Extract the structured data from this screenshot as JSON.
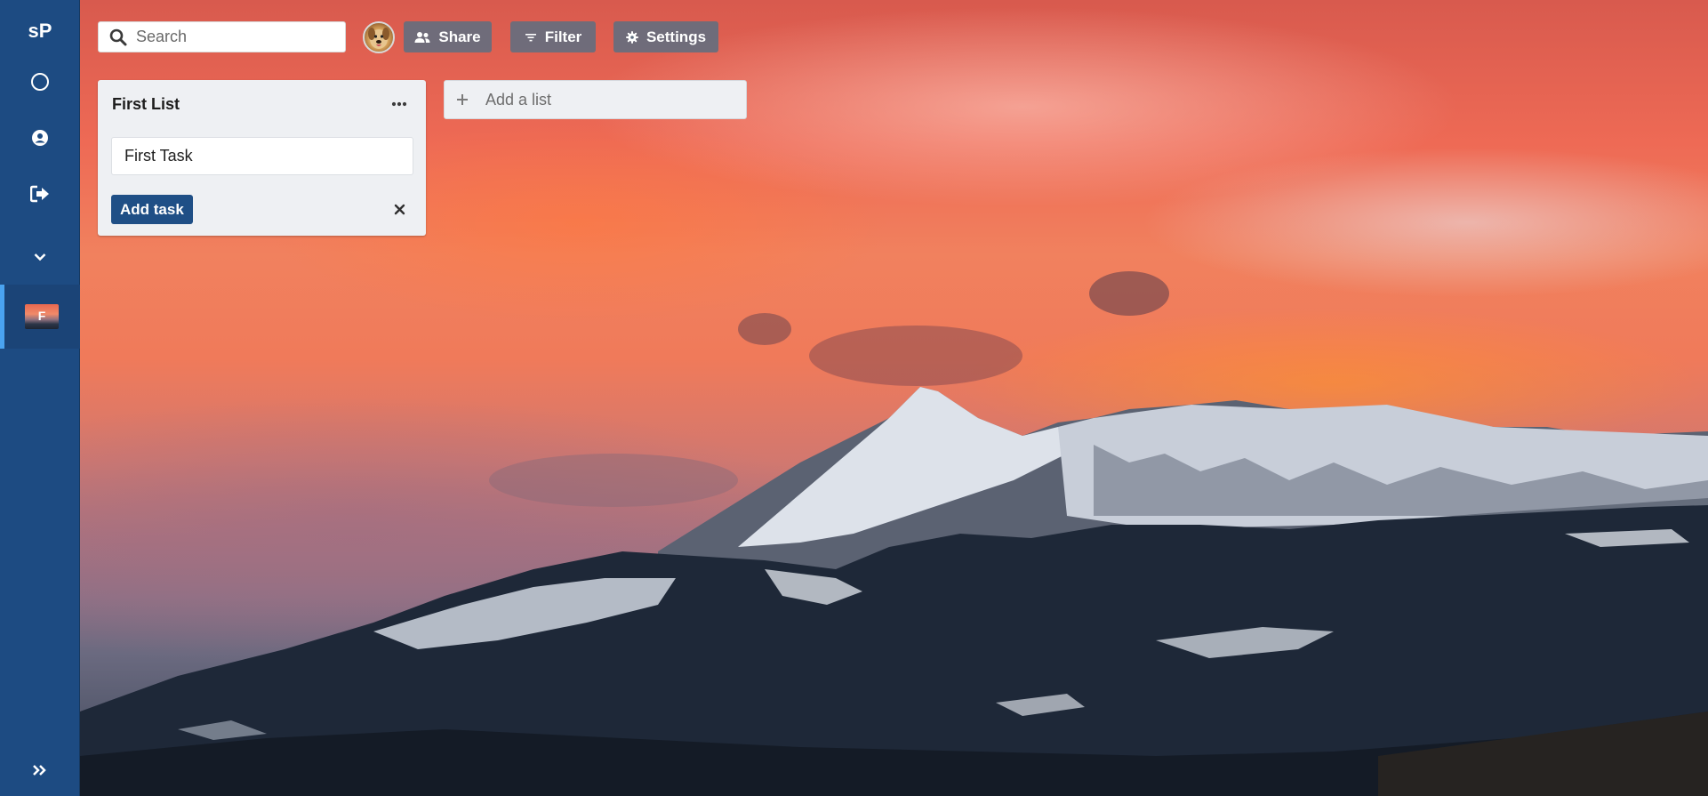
{
  "colors": {
    "sidebar_bg": "#1d4b82",
    "sidebar_active_indicator": "#4aa3f0",
    "toolbar_button_bg": "#606e80",
    "primary_button_bg": "#1f4f86",
    "list_bg": "#eef0f3"
  },
  "sidebar": {
    "logo": "sP",
    "icons": [
      "circle-icon",
      "user-circle-icon",
      "sign-out-icon",
      "chevron-down-icon"
    ],
    "boards": [
      {
        "thumbnail_letter": "F",
        "active": true
      }
    ],
    "footer_icon": "double-chevron-right-icon"
  },
  "toolbar": {
    "search_placeholder": "Search",
    "share_label": "Share",
    "filter_label": "Filter",
    "settings_label": "Settings"
  },
  "board": {
    "background": "sunset mountain landscape",
    "lists": [
      {
        "title": "First List",
        "new_task_value": "First Task",
        "add_task_label": "Add task"
      }
    ],
    "add_list_label": "Add a list"
  }
}
